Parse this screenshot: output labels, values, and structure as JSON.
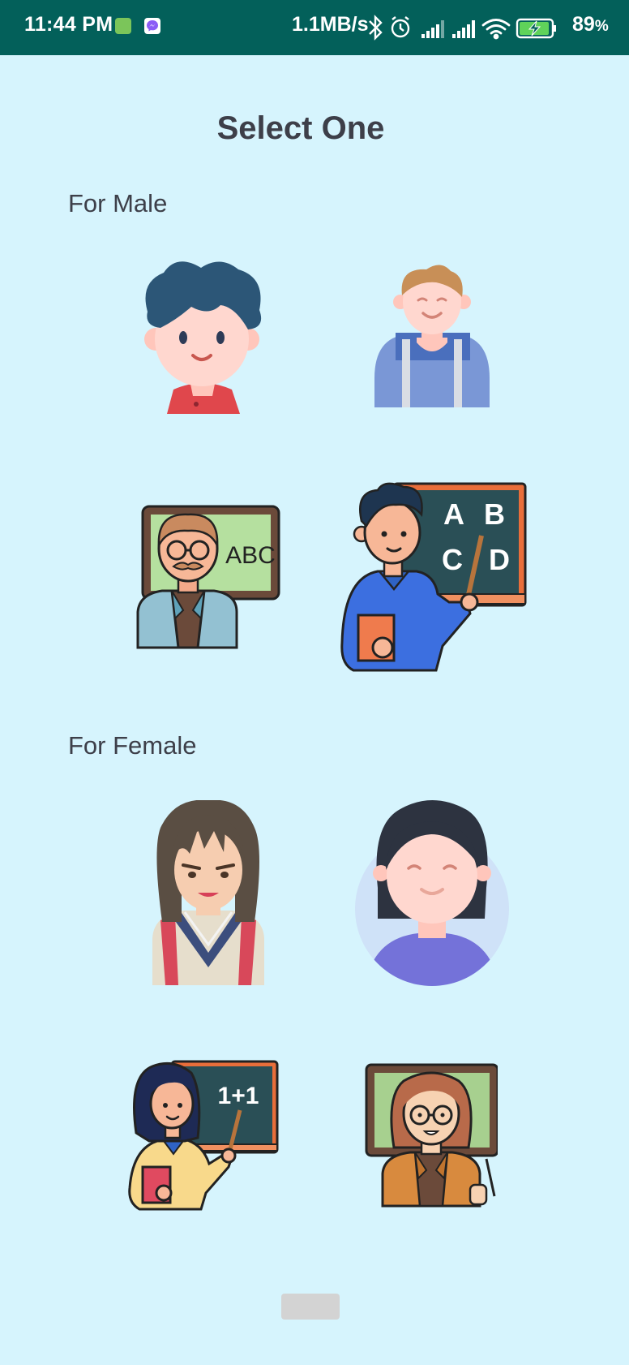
{
  "status_bar": {
    "time": "11:44 PM",
    "network_speed": "1.1MB/s",
    "battery_value": "89",
    "battery_unit": "%",
    "icons": [
      "app-icon",
      "messenger-icon",
      "bluetooth-icon",
      "alarm-icon",
      "signal-icon",
      "signal-icon",
      "wifi-icon",
      "battery-charging-icon"
    ]
  },
  "page": {
    "title": "Select One"
  },
  "sections": {
    "male": {
      "label": "For Male",
      "avatars": [
        "boy-curly-hair",
        "student-backpack",
        "teacher-glasses-blackboard",
        "teacher-pointer-abc"
      ]
    },
    "female": {
      "label": "For Female",
      "avatars": [
        "girl-school-uniform",
        "woman-circle",
        "female-teacher-blackboard",
        "female-teacher-glasses"
      ]
    }
  },
  "chalk": {
    "abc": "ABC",
    "a": "A",
    "b": "B",
    "c": "C",
    "d": "D",
    "math": "1+1"
  },
  "colors": {
    "status_bar": "#03605a",
    "background": "#d6f4fd",
    "text": "#3d3f49"
  }
}
